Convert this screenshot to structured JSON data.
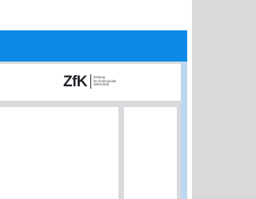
{
  "logo": {
    "mark": "ZfK",
    "tagline": [
      "Zeitung",
      "für kommunale",
      "Wirtschaft"
    ]
  },
  "colors": {
    "brand_blue": "#0c8ae6",
    "window_border": "#bcd7ef",
    "background_gray": "#d9d9d9"
  }
}
